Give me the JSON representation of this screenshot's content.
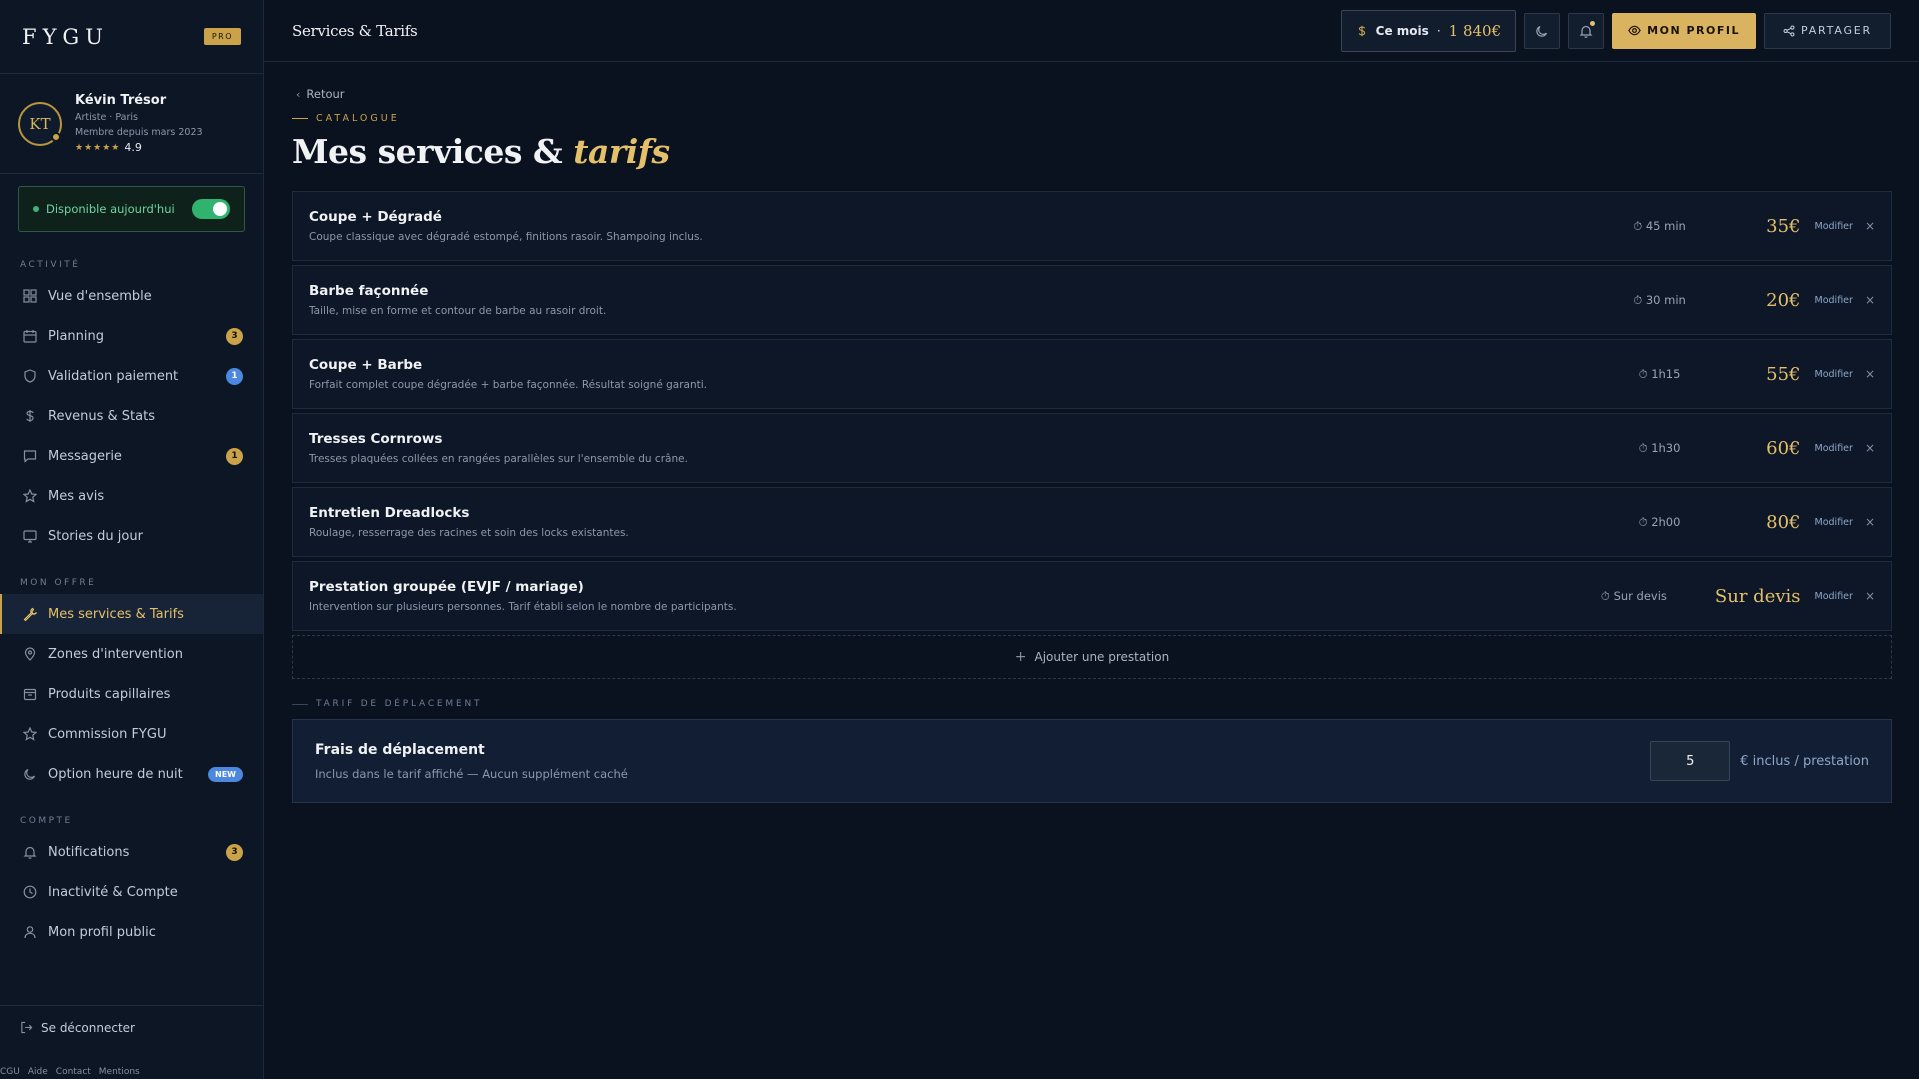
{
  "brand": {
    "logo": "FYGU",
    "badge": "PRO"
  },
  "profile": {
    "initials": "KT",
    "name": "Kévin Trésor",
    "role": "Artiste · Paris",
    "member_since": "Membre depuis mars 2023",
    "stars": "★★★★★",
    "rating": "4.9"
  },
  "availability": {
    "label": "Disponible aujourd'hui",
    "enabled": true
  },
  "sidebar": {
    "sections": [
      {
        "title": "ACTIVITÉ"
      },
      {
        "title": "MON OFFRE"
      },
      {
        "title": "COMPTE"
      }
    ],
    "items": [
      {
        "label": "Vue d'ensemble",
        "icon": "grid-icon"
      },
      {
        "label": "Planning",
        "icon": "calendar-icon",
        "badge": "3"
      },
      {
        "label": "Validation paiement",
        "icon": "shield-icon",
        "badge": "1"
      },
      {
        "label": "Revenus & Stats",
        "icon": "dollar-icon"
      },
      {
        "label": "Messagerie",
        "icon": "message-icon",
        "badge": "1"
      },
      {
        "label": "Mes avis",
        "icon": "star-icon"
      },
      {
        "label": "Stories du jour",
        "icon": "monitor-icon"
      },
      {
        "label": "Mes services & Tarifs",
        "icon": "tools-icon",
        "active": true
      },
      {
        "label": "Zones d'intervention",
        "icon": "pin-icon"
      },
      {
        "label": "Produits capillaires",
        "icon": "package-icon"
      },
      {
        "label": "Commission FYGU",
        "icon": "star-icon"
      },
      {
        "label": "Option heure de nuit",
        "icon": "moon-icon",
        "badge": "NEW"
      },
      {
        "label": "Notifications",
        "icon": "bell-icon",
        "badge": "3"
      },
      {
        "label": "Inactivité & Compte",
        "icon": "clock-icon"
      },
      {
        "label": "Mon profil public",
        "icon": "user-icon"
      }
    ],
    "logout": "Se déconnecter",
    "footer": [
      "CGU",
      "Aide",
      "Contact",
      "Mentions"
    ]
  },
  "topbar": {
    "title": "Services & Tarifs",
    "month_label": "Ce mois",
    "month_sep": "·",
    "month_amount": "1 840€",
    "profile_btn": "MON PROFIL",
    "share_btn": "PARTAGER"
  },
  "page": {
    "back": "Retour",
    "eyebrow": "CATALOGUE",
    "title_main": "Mes services &",
    "title_accent": "tarifs"
  },
  "services": [
    {
      "name": "Coupe + Dégradé",
      "desc": "Coupe classique avec dégradé estompé, finitions rasoir. Shampoing inclus.",
      "duration": "45 min",
      "price": "35€"
    },
    {
      "name": "Barbe façonnée",
      "desc": "Taille, mise en forme et contour de barbe au rasoir droit.",
      "duration": "30 min",
      "price": "20€"
    },
    {
      "name": "Coupe + Barbe",
      "desc": "Forfait complet coupe dégradée + barbe façonnée. Résultat soigné garanti.",
      "duration": "1h15",
      "price": "55€"
    },
    {
      "name": "Tresses Cornrows",
      "desc": "Tresses plaquées collées en rangées parallèles sur l'ensemble du crâne.",
      "duration": "1h30",
      "price": "60€"
    },
    {
      "name": "Entretien Dreadlocks",
      "desc": "Roulage, resserrage des racines et soin des locks existantes.",
      "duration": "2h00",
      "price": "80€"
    },
    {
      "name": "Prestation groupée (EVJF / mariage)",
      "desc": "Intervention sur plusieurs personnes. Tarif établi selon le nombre de participants.",
      "duration": "Sur devis",
      "price": "Sur devis"
    }
  ],
  "service_actions": {
    "edit": "Modifier",
    "remove": "×"
  },
  "add_service": "Ajouter une prestation",
  "travel": {
    "eyebrow": "TARIF DE DÉPLACEMENT",
    "title": "Frais de déplacement",
    "subtitle": "Inclus dans le tarif affiché — Aucun supplément caché",
    "value": "5",
    "unit": "€ inclus / prestation"
  },
  "colors": {
    "accent": "#c9a24a",
    "bg": "#0a1220",
    "success": "#2fb36e",
    "badge_blue": "#4c88e0"
  }
}
